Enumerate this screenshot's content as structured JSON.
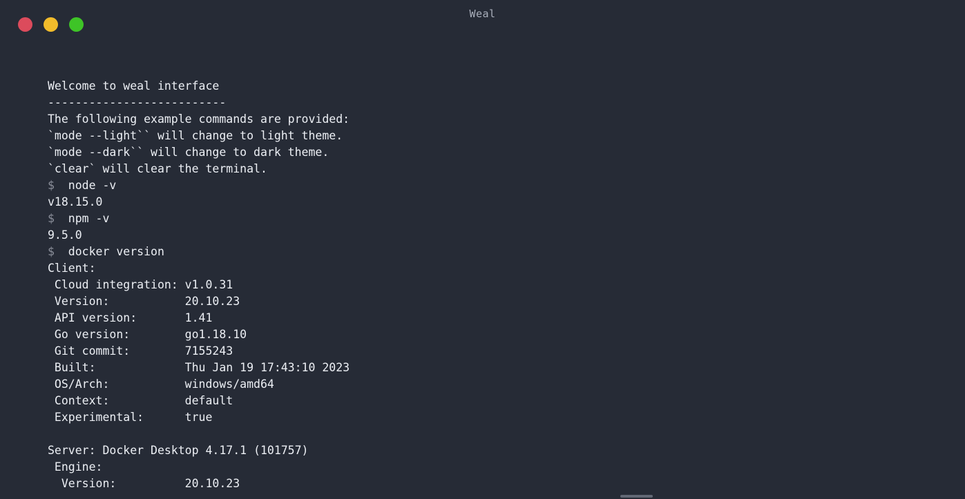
{
  "window": {
    "title": "Weal",
    "background_color": "#262b36",
    "foreground_color": "#eceff4",
    "controls": {
      "close_label": "",
      "minimize_label": "",
      "maximize_label": "",
      "close_color": "#dc4b5c",
      "minimize_color": "#f2bc2b",
      "maximize_color": "#3ec427"
    }
  },
  "terminal": {
    "prompt_sigil": "$",
    "prompt_color": "#8b8f9a",
    "banner": {
      "heading": "Welcome to weal interface",
      "rule": "--------------------------",
      "intro": "The following example commands are provided:",
      "help_lines": [
        "`mode --light`` will change to light theme.",
        "`mode --dark`` will change to dark theme.",
        "`clear` will clear the terminal."
      ]
    },
    "lines": [
      {
        "kind": "text",
        "text": "Welcome to weal interface"
      },
      {
        "kind": "text",
        "text": "--------------------------"
      },
      {
        "kind": "text",
        "text": "The following example commands are provided:"
      },
      {
        "kind": "text",
        "text": "`mode --light`` will change to light theme."
      },
      {
        "kind": "text",
        "text": "`mode --dark`` will change to dark theme."
      },
      {
        "kind": "text",
        "text": "`clear` will clear the terminal."
      },
      {
        "kind": "command",
        "command": "node -v"
      },
      {
        "kind": "text",
        "text": "v18.15.0"
      },
      {
        "kind": "command",
        "command": "npm -v"
      },
      {
        "kind": "text",
        "text": "9.5.0"
      },
      {
        "kind": "command",
        "command": "docker version"
      },
      {
        "kind": "text",
        "text": "Client:"
      },
      {
        "kind": "text",
        "text": " Cloud integration: v1.0.31"
      },
      {
        "kind": "text",
        "text": " Version:           20.10.23"
      },
      {
        "kind": "text",
        "text": " API version:       1.41"
      },
      {
        "kind": "text",
        "text": " Go version:        go1.18.10"
      },
      {
        "kind": "text",
        "text": " Git commit:        7155243"
      },
      {
        "kind": "text",
        "text": " Built:             Thu Jan 19 17:43:10 2023"
      },
      {
        "kind": "text",
        "text": " OS/Arch:           windows/amd64"
      },
      {
        "kind": "text",
        "text": " Context:           default"
      },
      {
        "kind": "text",
        "text": " Experimental:      true"
      },
      {
        "kind": "blank",
        "text": " "
      },
      {
        "kind": "text",
        "text": "Server: Docker Desktop 4.17.1 (101757)"
      },
      {
        "kind": "text",
        "text": " Engine:"
      },
      {
        "kind": "text",
        "text": "  Version:          20.10.23"
      }
    ],
    "commands": {
      "node_version": "node -v",
      "npm_version": "npm -v",
      "docker_version": "docker version"
    },
    "outputs": {
      "node_version_result": "v18.15.0",
      "npm_version_result": "9.5.0"
    },
    "docker_client": {
      "section_label": "Client:",
      "rows": [
        {
          "label": "Cloud integration:",
          "value": "v1.0.31"
        },
        {
          "label": "Version:",
          "value": "20.10.23"
        },
        {
          "label": "API version:",
          "value": "1.41"
        },
        {
          "label": "Go version:",
          "value": "go1.18.10"
        },
        {
          "label": "Git commit:",
          "value": "7155243"
        },
        {
          "label": "Built:",
          "value": "Thu Jan 19 17:43:10 2023"
        },
        {
          "label": "OS/Arch:",
          "value": "windows/amd64"
        },
        {
          "label": "Context:",
          "value": "default"
        },
        {
          "label": "Experimental:",
          "value": "true"
        }
      ]
    },
    "docker_server": {
      "section_label": "Server: Docker Desktop 4.17.1 (101757)",
      "engine_label": " Engine:",
      "rows": [
        {
          "label": "Version:",
          "value": "20.10.23"
        }
      ]
    }
  },
  "scrollbar": {
    "orientation": "horizontal",
    "thumb_color": "#6d7380"
  }
}
